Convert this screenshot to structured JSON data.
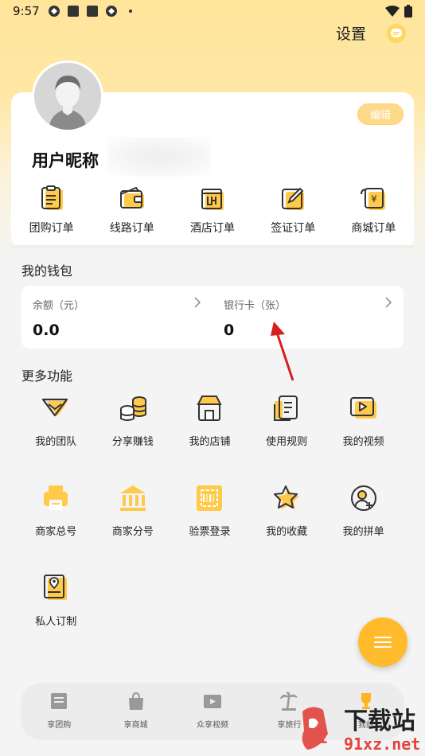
{
  "status": {
    "time": "9:57"
  },
  "header": {
    "settings_label": "设置"
  },
  "profile": {
    "nickname": "用户昵称",
    "edit_label": "编辑"
  },
  "orders": [
    {
      "label": "团购订单",
      "icon": "group-order-icon"
    },
    {
      "label": "线路订单",
      "icon": "route-order-icon"
    },
    {
      "label": "酒店订单",
      "icon": "hotel-order-icon"
    },
    {
      "label": "签证订单",
      "icon": "visa-order-icon"
    },
    {
      "label": "商城订单",
      "icon": "mall-order-icon"
    }
  ],
  "wallet": {
    "title": "我的钱包",
    "balance_label": "余额（元）",
    "balance_value": "0.0",
    "bankcard_label": "银行卡（张）",
    "bankcard_value": "0"
  },
  "more": {
    "title": "更多功能",
    "items": [
      {
        "label": "我的团队",
        "icon": "team-icon"
      },
      {
        "label": "分享赚钱",
        "icon": "coins-icon"
      },
      {
        "label": "我的店铺",
        "icon": "shop-icon"
      },
      {
        "label": "使用规则",
        "icon": "rules-icon"
      },
      {
        "label": "我的视频",
        "icon": "video-icon"
      },
      {
        "label": "商家总号",
        "icon": "printer-icon"
      },
      {
        "label": "商家分号",
        "icon": "bank-icon"
      },
      {
        "label": "验票登录",
        "icon": "ticket-scan-icon"
      },
      {
        "label": "我的收藏",
        "icon": "star-icon"
      },
      {
        "label": "我的拼单",
        "icon": "group-buy-icon"
      },
      {
        "label": "私人订制",
        "icon": "custom-tour-icon"
      }
    ]
  },
  "bottom_nav": [
    {
      "label": "享团购",
      "icon": "tuangou-icon"
    },
    {
      "label": "享商城",
      "icon": "bag-icon"
    },
    {
      "label": "众享视频",
      "icon": "film-icon"
    },
    {
      "label": "享旅行",
      "icon": "palm-icon"
    },
    {
      "label": "我的",
      "icon": "trophy-icon"
    }
  ],
  "colors": {
    "accent": "#ffbb2c",
    "header_bg": "#ffe49a",
    "icon_fill": "#ffc94a"
  }
}
